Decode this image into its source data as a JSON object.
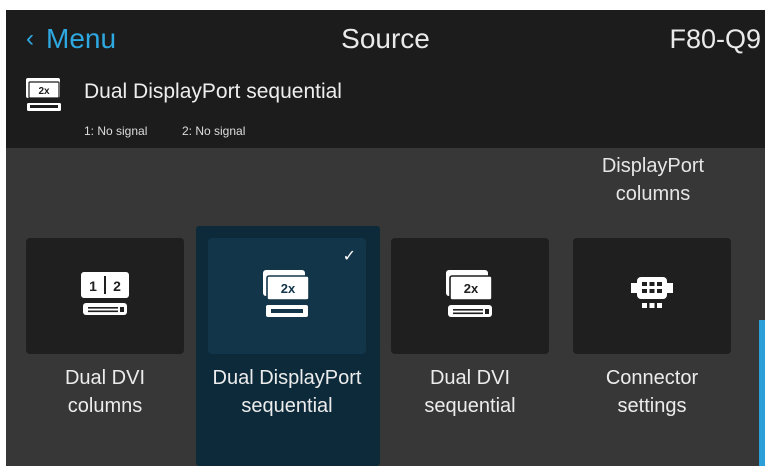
{
  "header": {
    "back_label": "Menu",
    "title": "Source",
    "model": "F80-Q9"
  },
  "current_source": {
    "icon_badge": "2x",
    "name": "Dual DisplayPort sequential",
    "signal_1": "1:  No signal",
    "signal_2": "2:  No signal"
  },
  "partial_item": {
    "label": "DisplayPort columns"
  },
  "tiles": [
    {
      "label": "Dual DVI columns",
      "icon": "dual-dvi-columns-icon",
      "badge_1": "1",
      "badge_2": "2"
    },
    {
      "label": "Dual DisplayPort sequential",
      "icon": "dual-displayport-sequential-icon",
      "badge": "2x",
      "selected": true
    },
    {
      "label": "Dual DVI sequential",
      "icon": "dual-dvi-sequential-icon",
      "badge": "2x"
    },
    {
      "label": "Connector settings",
      "icon": "connector-icon"
    }
  ],
  "colors": {
    "accent": "#2ea8e0",
    "background": "#373737",
    "panel": "#1c1c1c",
    "tile": "#1f1f1f",
    "selected": "#123549"
  }
}
